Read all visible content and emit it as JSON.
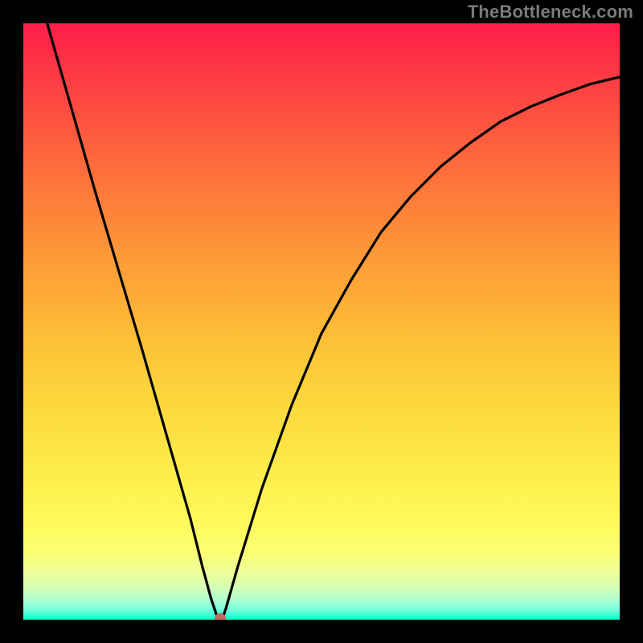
{
  "watermark": "TheBottleneck.com",
  "colors": {
    "frame": "#000000",
    "curve": "#000000",
    "marker": "#c46a60"
  },
  "chart_data": {
    "type": "line",
    "title": "",
    "xlabel": "",
    "ylabel": "",
    "xlim": [
      0,
      100
    ],
    "ylim": [
      0,
      100
    ],
    "series": [
      {
        "name": "bottleneck-curve",
        "x": [
          4,
          8,
          12,
          16,
          20,
          24,
          28,
          30,
          31.5,
          32.5,
          33,
          33.5,
          34,
          36,
          40,
          45,
          50,
          55,
          60,
          65,
          70,
          75,
          80,
          85,
          90,
          95,
          100
        ],
        "y": [
          100,
          86,
          72,
          58.5,
          45,
          31,
          17,
          9,
          3.5,
          0.5,
          0,
          0.5,
          2,
          9,
          22,
          36,
          48,
          57,
          65,
          71,
          76,
          80,
          83.5,
          86,
          88,
          89.8,
          91
        ]
      }
    ],
    "annotations": [
      {
        "name": "optimum-marker",
        "x": 33,
        "y": 0.3
      }
    ],
    "grid": false,
    "legend": false,
    "background_gradient": {
      "direction": "vertical",
      "stops": [
        {
          "pos": 0.0,
          "color": "#fd1d49"
        },
        {
          "pos": 0.5,
          "color": "#fdbb37"
        },
        {
          "pos": 0.85,
          "color": "#fdfb5e"
        },
        {
          "pos": 1.0,
          "color": "#00ffc4"
        }
      ]
    }
  }
}
